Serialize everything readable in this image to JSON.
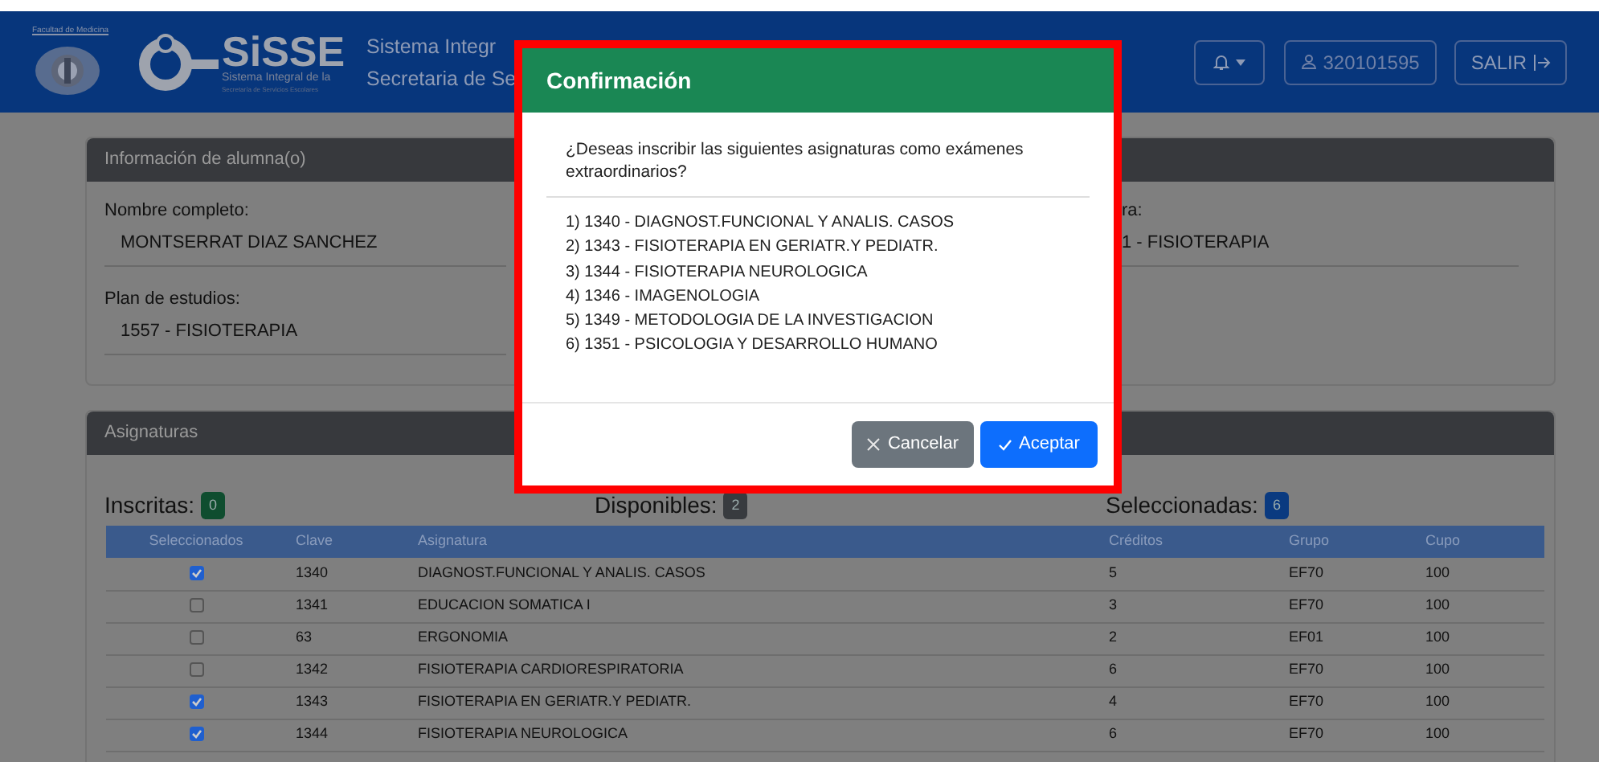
{
  "header": {
    "faculty": "Facultad de Medicina",
    "logo_text": "SiSSE",
    "logo_subtitle": "Sistema Integral de la",
    "logo_caption": "Secretaría de Servicios Escolares",
    "title_lines": [
      "Sistema Integr",
      "Secretaria de Se"
    ],
    "user": "320101595",
    "logout": "SALIR"
  },
  "student_card": {
    "title": "Información de alumna(o)",
    "fields": [
      {
        "label": "Nombre completo:",
        "value": "MONTSERRAT DIAZ SANCHEZ"
      },
      {
        "label": "Plan de estudios:",
        "value": "1557 - FISIOTERAPIA"
      }
    ],
    "right_field": {
      "label": "ra:",
      "value": "1 - FISIOTERAPIA"
    }
  },
  "subjects_card": {
    "title": "Asignaturas",
    "counters": [
      {
        "label": "Inscritas:",
        "count": "0",
        "color": "#0f4d2f"
      },
      {
        "label": "Disponibles:",
        "count": "2",
        "color": "#383b3f"
      },
      {
        "label": "Seleccionadas:",
        "count": "6",
        "color": "#0a3a80"
      }
    ],
    "columns": [
      "Seleccionados",
      "Clave",
      "Asignatura",
      "Créditos",
      "Grupo",
      "Cupo"
    ],
    "rows": [
      {
        "selected": true,
        "cells": [
          "",
          "1340",
          "DIAGNOST.FUNCIONAL Y ANALIS. CASOS",
          "5",
          "EF70",
          "100"
        ]
      },
      {
        "selected": false,
        "cells": [
          "",
          "1341",
          "EDUCACION SOMATICA I",
          "3",
          "EF70",
          "100"
        ]
      },
      {
        "selected": false,
        "cells": [
          "",
          "63",
          "ERGONOMIA",
          "2",
          "EF01",
          "100"
        ]
      },
      {
        "selected": false,
        "cells": [
          "",
          "1342",
          "FISIOTERAPIA CARDIORESPIRATORIA",
          "6",
          "EF70",
          "100"
        ]
      },
      {
        "selected": true,
        "cells": [
          "",
          "1343",
          "FISIOTERAPIA EN GERIATR.Y PEDIATR.",
          "4",
          "EF70",
          "100"
        ]
      },
      {
        "selected": true,
        "cells": [
          "",
          "1344",
          "FISIOTERAPIA NEUROLOGICA",
          "6",
          "EF70",
          "100"
        ]
      }
    ]
  },
  "dialog": {
    "title": "Confirmación",
    "question": "¿Deseas inscribir las siguientes asignaturas como exámenes extraordinarios?",
    "items": [
      "1) 1340 - DIAGNOST.FUNCIONAL Y ANALIS. CASOS",
      "2) 1343 - FISIOTERAPIA EN GERIATR.Y PEDIATR.",
      "3) 1344 - FISIOTERAPIA NEUROLOGICA",
      "4) 1346 - IMAGENOLOGIA",
      "5) 1349 - METODOLOGIA DE LA INVESTIGACION",
      "6) 1351 - PSICOLOGIA Y DESARROLLO HUMANO"
    ],
    "buttons": [
      {
        "label": "Cancelar",
        "kind": "cancel"
      },
      {
        "label": "Aceptar",
        "kind": "accept"
      }
    ]
  }
}
